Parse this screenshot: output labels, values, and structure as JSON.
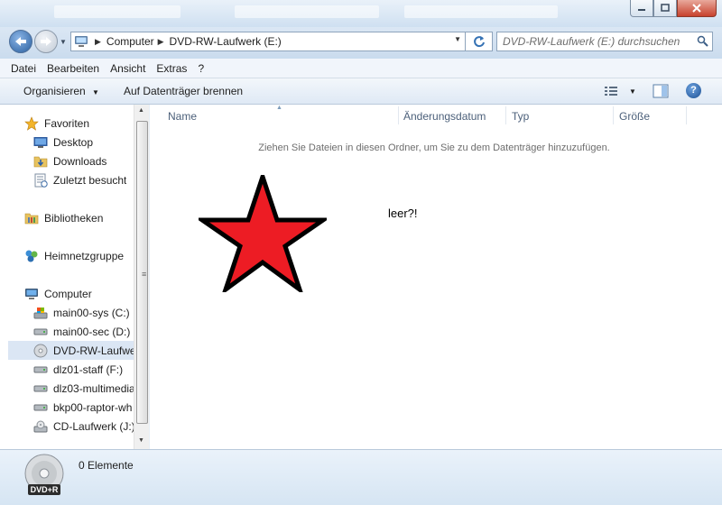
{
  "address": {
    "crumbs": [
      "Computer",
      "DVD-RW-Laufwerk (E:)"
    ],
    "search_placeholder": "DVD-RW-Laufwerk (E:) durchsuchen"
  },
  "menubar": [
    "Datei",
    "Bearbeiten",
    "Ansicht",
    "Extras",
    "?"
  ],
  "toolbar": {
    "organize": "Organisieren",
    "burn": "Auf Datenträger brennen"
  },
  "navpane": {
    "favorites": {
      "label": "Favoriten",
      "items": [
        "Desktop",
        "Downloads",
        "Zuletzt besucht"
      ]
    },
    "libraries": "Bibliotheken",
    "homegroup": "Heimnetzgruppe",
    "computer": {
      "label": "Computer",
      "items": [
        {
          "label": "main00-sys (C:)",
          "icon": "system-drive-icon"
        },
        {
          "label": "main00-sec (D:)",
          "icon": "hard-drive-icon"
        },
        {
          "label": "DVD-RW-Laufwerk (E:)",
          "icon": "dvd-drive-icon",
          "selected": true
        },
        {
          "label": "dlz01-staff (F:)",
          "icon": "hard-drive-icon"
        },
        {
          "label": "dlz03-multimedia",
          "icon": "hard-drive-icon"
        },
        {
          "label": "bkp00-raptor-wh",
          "icon": "hard-drive-icon"
        },
        {
          "label": "CD-Laufwerk (J:)",
          "icon": "cd-drive-icon"
        }
      ]
    }
  },
  "filelist": {
    "columns": [
      "Name",
      "Änderungsdatum",
      "Typ",
      "Größe"
    ],
    "empty_message": "Ziehen Sie Dateien in diesen Ordner, um Sie zu dem Datenträger hinzuzufügen.",
    "annotation": "leer?!"
  },
  "details": {
    "status": "0 Elemente",
    "icon_label": "DVD+R"
  },
  "colors": {
    "star": "#ed1c24",
    "selection": "#dbe6f4"
  }
}
